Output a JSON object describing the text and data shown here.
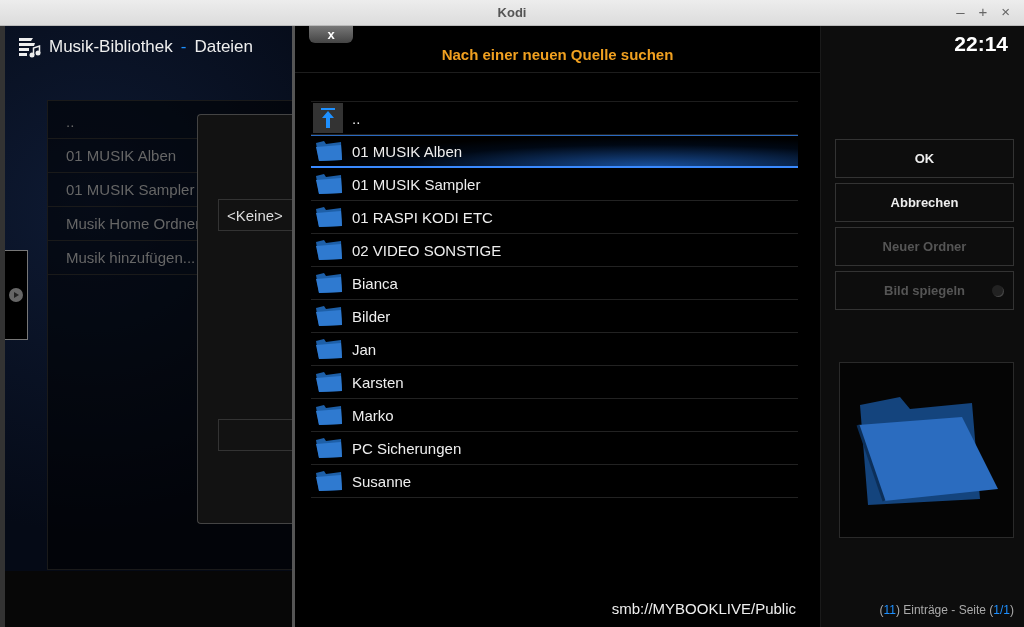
{
  "window": {
    "title": "Kodi",
    "controls": [
      "–",
      "+",
      "×"
    ]
  },
  "header": {
    "title": "Musik-Bibliothek",
    "separator": "-",
    "subtitle": "Dateien"
  },
  "library_list": {
    "items": [
      {
        "label": ".."
      },
      {
        "label": "01 MUSIK Alben"
      },
      {
        "label": "01 MUSIK Sampler"
      },
      {
        "label": "Musik Home Ordner"
      },
      {
        "label": "Musik hinzufügen..."
      }
    ]
  },
  "background_dialog": {
    "field_value": "<Keine>"
  },
  "dialog": {
    "close": "x",
    "title": "Nach einer neuen Quelle suchen",
    "parent_row": "..",
    "folders": [
      {
        "name": "01 MUSIK Alben",
        "selected": true
      },
      {
        "name": "01 MUSIK Sampler",
        "selected": false
      },
      {
        "name": "01 RASPI KODI ETC",
        "selected": false
      },
      {
        "name": "02 VIDEO SONSTIGE",
        "selected": false
      },
      {
        "name": "Bianca",
        "selected": false
      },
      {
        "name": "Bilder",
        "selected": false
      },
      {
        "name": "Jan",
        "selected": false
      },
      {
        "name": "Karsten",
        "selected": false
      },
      {
        "name": "Marko",
        "selected": false
      },
      {
        "name": "PC Sicherungen",
        "selected": false
      },
      {
        "name": "Susanne",
        "selected": false
      }
    ],
    "path": "smb://MYBOOKLIVE/Public"
  },
  "clock": "22:14",
  "buttons": [
    {
      "label": "OK",
      "kind": "button",
      "disabled": false
    },
    {
      "label": "Abbrechen",
      "kind": "button",
      "disabled": false
    },
    {
      "label": "Neuer Ordner",
      "kind": "button",
      "disabled": true
    },
    {
      "label": "Bild spiegeln",
      "kind": "toggle",
      "disabled": true,
      "on": false
    }
  ],
  "entries_info": [
    {
      "text": "(",
      "kind": "plain"
    },
    {
      "text": "11",
      "kind": "value"
    },
    {
      "text": ") Einträge - Seite (",
      "kind": "plain"
    },
    {
      "text": "1/1",
      "kind": "value"
    },
    {
      "text": ")",
      "kind": "plain"
    }
  ]
}
